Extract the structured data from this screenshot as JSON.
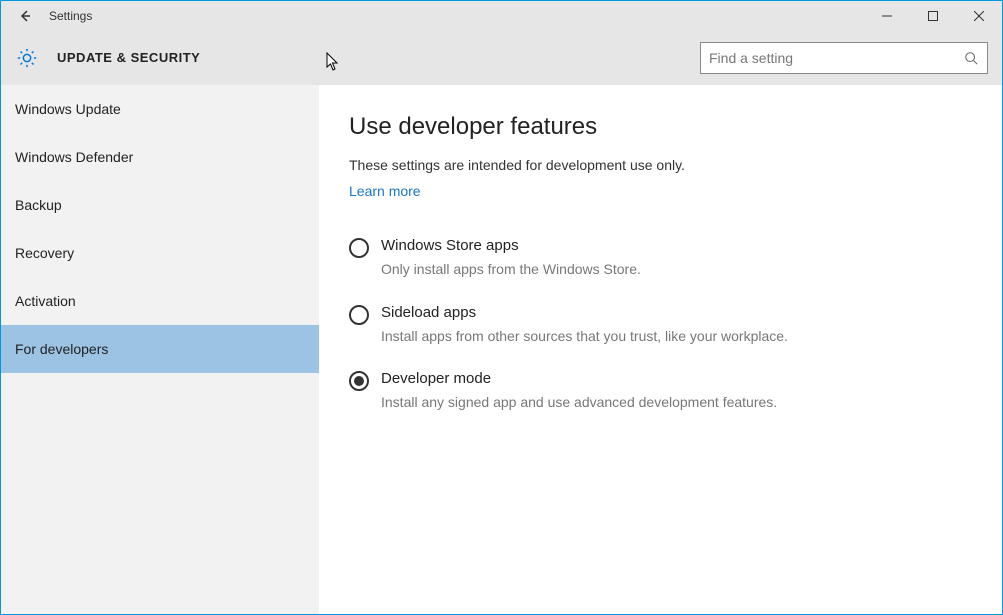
{
  "window": {
    "title": "Settings"
  },
  "header": {
    "section_title": "UPDATE & SECURITY",
    "search_placeholder": "Find a setting"
  },
  "sidebar": {
    "items": [
      {
        "label": "Windows Update"
      },
      {
        "label": "Windows Defender"
      },
      {
        "label": "Backup"
      },
      {
        "label": "Recovery"
      },
      {
        "label": "Activation"
      },
      {
        "label": "For developers"
      }
    ],
    "selected_index": 5
  },
  "content": {
    "heading": "Use developer features",
    "subtext": "These settings are intended for development use only.",
    "learn_more": "Learn more",
    "options": [
      {
        "label": "Windows Store apps",
        "desc": "Only install apps from the Windows Store."
      },
      {
        "label": "Sideload apps",
        "desc": "Install apps from other sources that you trust, like your workplace."
      },
      {
        "label": "Developer mode",
        "desc": "Install any signed app and use advanced development features."
      }
    ],
    "selected_option_index": 2
  }
}
